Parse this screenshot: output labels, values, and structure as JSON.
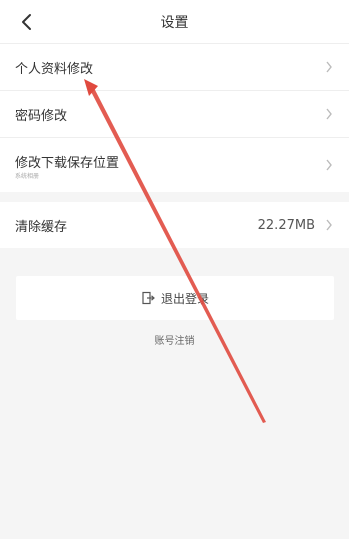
{
  "header": {
    "title": "设置",
    "back_icon": "chevron-left-icon"
  },
  "settings": {
    "items": [
      {
        "label": "个人资料修改",
        "icon": "chevron-right-icon"
      },
      {
        "label": "密码修改",
        "icon": "chevron-right-icon"
      },
      {
        "label": "修改下载保存位置",
        "sub": "系统相册",
        "icon": "chevron-right-icon"
      }
    ],
    "cache": {
      "label": "清除缓存",
      "value": "22.27MB",
      "icon": "chevron-right-icon"
    }
  },
  "logout": {
    "label": "退出登录",
    "icon": "logout-icon"
  },
  "account_cancel": {
    "label": "账号注销"
  },
  "colors": {
    "background": "#f5f5f5",
    "card": "#ffffff",
    "annotation_arrow": "#e04a3f"
  }
}
